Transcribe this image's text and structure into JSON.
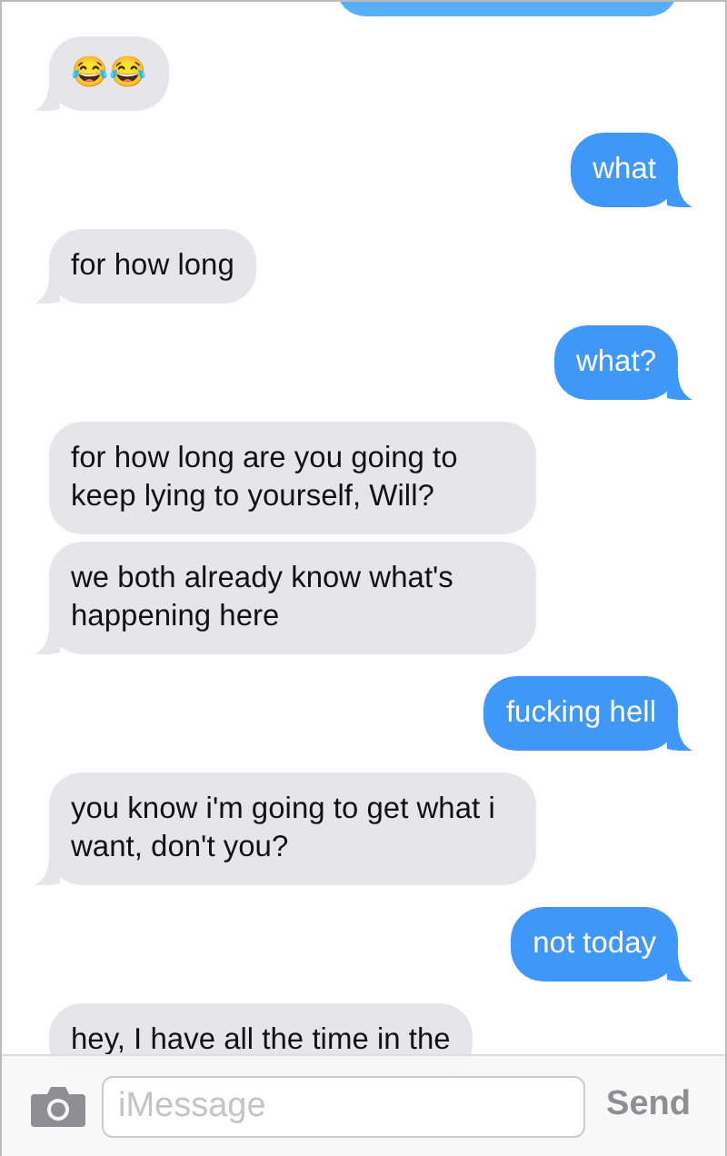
{
  "messages": [
    {
      "kind": "received",
      "text": "😂😂",
      "tail": true
    },
    {
      "kind": "sent",
      "text": "what",
      "tail": true
    },
    {
      "kind": "received",
      "text": "for how long",
      "tail": true
    },
    {
      "kind": "sent",
      "text": "what?",
      "tail": true
    },
    {
      "kind": "received",
      "text": "for how long are you going to keep lying to yourself, Will?",
      "tail": false
    },
    {
      "kind": "received",
      "text": "we both already know what's happening here",
      "tail": true
    },
    {
      "kind": "sent",
      "text": "fucking hell",
      "tail": true
    },
    {
      "kind": "received",
      "text": "you know i'm going to get what i want, don't you?",
      "tail": true
    },
    {
      "kind": "sent",
      "text": "not today",
      "tail": true
    },
    {
      "kind": "received",
      "text": "hey, I have all the time in the"
    }
  ],
  "composer": {
    "placeholder": "iMessage",
    "send": "Send"
  }
}
